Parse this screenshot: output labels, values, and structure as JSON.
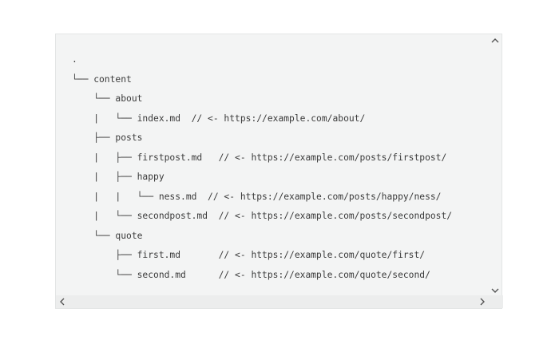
{
  "code_block": {
    "lines": [
      ".",
      "└── content",
      "    └── about",
      "    |   └── index.md  // <- https://example.com/about/",
      "    ├── posts",
      "    |   ├── firstpost.md   // <- https://example.com/posts/firstpost/",
      "    |   ├── happy",
      "    |   |   └── ness.md  // <- https://example.com/posts/happy/ness/",
      "    |   └── secondpost.md  // <- https://example.com/posts/secondpost/",
      "    └── quote",
      "        ├── first.md       // <- https://example.com/quote/first/",
      "        └── second.md      // <- https://example.com/quote/second/"
    ]
  },
  "scrollbars": {
    "vertical": {
      "up_icon": "chevron-up-icon",
      "down_icon": "chevron-down-icon"
    },
    "horizontal": {
      "left_icon": "chevron-left-icon",
      "right_icon": "chevron-right-icon"
    }
  }
}
